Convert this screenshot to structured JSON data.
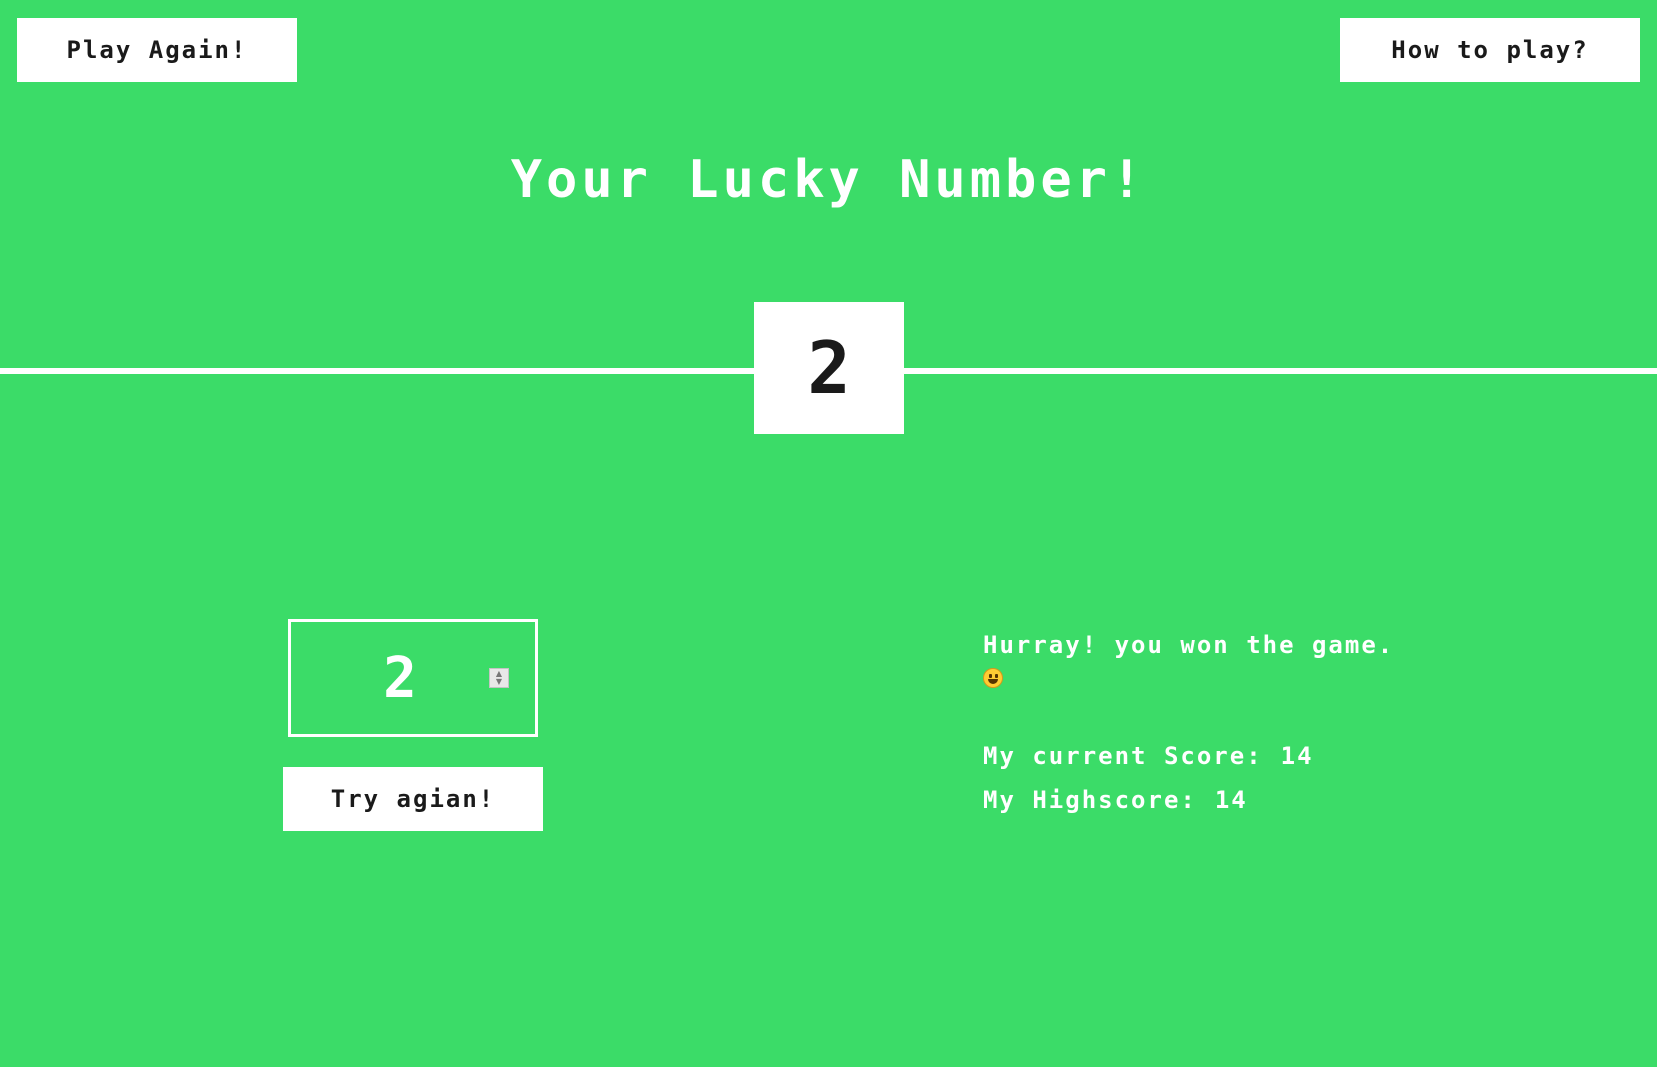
{
  "header": {
    "play_again_label": "Play Again!",
    "how_to_play_label": "How to play?"
  },
  "main": {
    "title": "Your Lucky Number!",
    "lucky_number": "2"
  },
  "guess": {
    "input_value": "2",
    "try_again_label": "Try agian!"
  },
  "result": {
    "message": "Hurray! you won the game.",
    "emoji_icon": "grinning-face-icon",
    "current_score_label": "My current Score:",
    "current_score_value": "14",
    "highscore_label": "My Highscore:",
    "highscore_value": "14"
  },
  "colors": {
    "background": "#3bdc68",
    "foreground": "#ffffff",
    "text_dark": "#1a1a1a"
  }
}
